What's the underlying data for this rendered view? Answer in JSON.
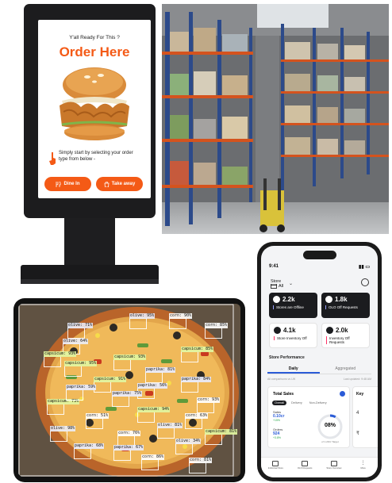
{
  "kiosk": {
    "ready_text": "Y'all Ready For This ?",
    "title": "Order Here",
    "help_text": "Simply start by selecting your order type from below -",
    "dine_in_label": "Dine In",
    "take_away_label": "Take away",
    "accent_color": "#f45a16"
  },
  "pizza_detections": [
    {
      "label": "olive: 95%",
      "kind": "olive"
    },
    {
      "label": "olive: 71%",
      "kind": "olive"
    },
    {
      "label": "olive: 64%",
      "kind": "olive"
    },
    {
      "label": "corn: 90%",
      "kind": "corn"
    },
    {
      "label": "corn: 85%",
      "kind": "corn"
    },
    {
      "label": "capsicum: 93%",
      "kind": "capsicum"
    },
    {
      "label": "capsicum: 95%",
      "kind": "capsicum"
    },
    {
      "label": "capsicum: 93%",
      "kind": "capsicum"
    },
    {
      "label": "capsicum: 85%",
      "kind": "capsicum"
    },
    {
      "label": "capsicum: 73%",
      "kind": "capsicum"
    },
    {
      "label": "capsicum: 91%",
      "kind": "capsicum"
    },
    {
      "label": "paprika: 81%",
      "kind": "paprika"
    },
    {
      "label": "paprika: 84%",
      "kind": "paprika"
    },
    {
      "label": "paprika: 56%",
      "kind": "paprika"
    },
    {
      "label": "paprika: 75%",
      "kind": "paprika"
    },
    {
      "label": "paprika: 59%",
      "kind": "paprika"
    },
    {
      "label": "corn: 93%",
      "kind": "corn"
    },
    {
      "label": "corn: 51%",
      "kind": "corn"
    },
    {
      "label": "corn: 63%",
      "kind": "corn"
    },
    {
      "label": "corn: 86%",
      "kind": "corn"
    },
    {
      "label": "olive: 98%",
      "kind": "olive"
    },
    {
      "label": "capsicum: 94%",
      "kind": "capsicum"
    },
    {
      "label": "olive: 81%",
      "kind": "olive"
    },
    {
      "label": "paprika: 68%",
      "kind": "paprika"
    },
    {
      "label": "corn: 76%",
      "kind": "corn"
    },
    {
      "label": "capsicum: 81%",
      "kind": "capsicum"
    },
    {
      "label": "paprika: 67%",
      "kind": "paprika"
    },
    {
      "label": "olive: 34%",
      "kind": "olive"
    },
    {
      "label": "corn: 81%",
      "kind": "corn"
    }
  ],
  "phone": {
    "time": "9:41",
    "store_label": "Store",
    "store_value": "All",
    "cards": [
      {
        "value": "2.2k",
        "label": "Stores are Offline"
      },
      {
        "value": "1.8k",
        "label": "OLO Off Requests"
      },
      {
        "value": "4.1k",
        "label": "Store Inventory Off"
      },
      {
        "value": "2.0k",
        "label": "Inventory Off Requests"
      }
    ],
    "section_title": "Store Performance",
    "tabs": [
      "Daily",
      "Aggregated"
    ],
    "sub_left": "All comparisons vs LW",
    "sub_right": "Last updated: 9:48 AM",
    "sales": {
      "title": "Total Sales",
      "chips": [
        "Overall",
        "Delivery",
        "Non-Delivery"
      ],
      "sales_label": "Sales",
      "sales_value": "0.10cr",
      "sales_change": "+15%",
      "orders_label": "Orders",
      "orders_value": "924",
      "orders_change": "+3.8%",
      "donut_value": "08%",
      "donut_sub": "of 1.20Cr Target",
      "donut_fraction": 0.08
    },
    "second_card": {
      "label": "Key",
      "v1": "4",
      "v2": "₹"
    },
    "nav": [
      "Individual Store",
      "OLO Requests",
      "Store Overview",
      "More"
    ]
  }
}
